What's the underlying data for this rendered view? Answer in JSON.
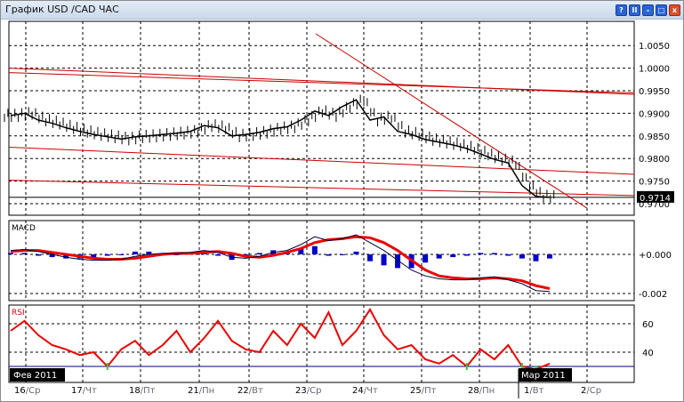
{
  "window": {
    "title": "График USD /CAD  ЧАС",
    "buttons": [
      {
        "name": "help",
        "glyph": "?"
      },
      {
        "name": "pause",
        "glyph": "II"
      },
      {
        "name": "minimize",
        "glyph": "–"
      },
      {
        "name": "restore",
        "glyph": "□"
      },
      {
        "name": "close",
        "glyph": "x"
      }
    ]
  },
  "colors": {
    "price": "#000000",
    "trend": "#cc0000",
    "macd_line": "#000033",
    "signal": "#ee0000",
    "histogram": "#0000cc",
    "rsi": "#ee0000",
    "rsi_level": "#000080",
    "highlight": "#33cc33"
  },
  "chart_data": [
    {
      "type": "line",
      "name": "price",
      "title": "USD/CAD H1",
      "yticks": [
        "1.0050",
        "1.0000",
        "0.9950",
        "0.9900",
        "0.9850",
        "0.9800",
        "0.9750",
        "0.9700"
      ],
      "ylim": [
        0.9685,
        1.0095
      ],
      "current_price": "0.9714",
      "closes": [
        0.9895,
        0.99,
        0.9885,
        0.9878,
        0.9868,
        0.986,
        0.9853,
        0.9848,
        0.9843,
        0.9848,
        0.985,
        0.9853,
        0.9856,
        0.986,
        0.9873,
        0.9868,
        0.985,
        0.9853,
        0.9858,
        0.9866,
        0.987,
        0.9885,
        0.9905,
        0.9895,
        0.9915,
        0.993,
        0.9885,
        0.9892,
        0.986,
        0.9853,
        0.9842,
        0.9836,
        0.983,
        0.9822,
        0.981,
        0.9798,
        0.979,
        0.974,
        0.9716,
        0.9714
      ],
      "trendlines": [
        {
          "from": 1.0,
          "to": 0.9942
        },
        {
          "from": 0.999,
          "to": 0.9945
        },
        {
          "from": 0.9825,
          "to": 0.9765
        },
        {
          "from": 0.9752,
          "to": 0.9718
        }
      ],
      "diagonal": {
        "from": 1.0076,
        "to": 0.969
      }
    },
    {
      "type": "line",
      "name": "MACD",
      "label": "MACD",
      "yticks": [
        "+0.000",
        "-0.002"
      ],
      "unit": 0.001,
      "macd": [
        0.2,
        0.25,
        0.15,
        0.0,
        -0.15,
        -0.25,
        -0.3,
        -0.3,
        -0.25,
        -0.1,
        0.0,
        0.05,
        0.05,
        0.1,
        0.2,
        0.1,
        -0.15,
        -0.2,
        -0.1,
        0.1,
        0.2,
        0.5,
        0.9,
        0.7,
        0.8,
        1.0,
        0.6,
        0.2,
        -0.3,
        -0.8,
        -1.1,
        -1.25,
        -1.3,
        -1.3,
        -1.2,
        -1.15,
        -1.3,
        -1.5,
        -1.85,
        -1.9
      ],
      "signal": [
        0.15,
        0.2,
        0.2,
        0.1,
        0.0,
        -0.1,
        -0.2,
        -0.25,
        -0.25,
        -0.2,
        -0.1,
        0.0,
        0.05,
        0.05,
        0.1,
        0.15,
        0.05,
        -0.1,
        -0.15,
        -0.05,
        0.1,
        0.3,
        0.6,
        0.75,
        0.8,
        0.9,
        0.85,
        0.6,
        0.2,
        -0.3,
        -0.8,
        -1.1,
        -1.2,
        -1.25,
        -1.25,
        -1.2,
        -1.25,
        -1.35,
        -1.6,
        -1.75
      ]
    },
    {
      "type": "line",
      "name": "RSI",
      "label": "RSI",
      "yticks": [
        "60",
        "40"
      ],
      "level": 30,
      "values": [
        55,
        62,
        52,
        45,
        42,
        38,
        40,
        30,
        42,
        48,
        38,
        45,
        55,
        40,
        50,
        62,
        48,
        42,
        40,
        55,
        45,
        60,
        50,
        68,
        45,
        55,
        70,
        52,
        42,
        45,
        35,
        32,
        38,
        30,
        42,
        35,
        45,
        30,
        28,
        32
      ]
    }
  ],
  "xaxis": {
    "ticks": [
      {
        "day": "16",
        "wd": "Ср"
      },
      {
        "day": "17",
        "wd": "Чт"
      },
      {
        "day": "18",
        "wd": "Пт"
      },
      {
        "day": "21",
        "wd": "Пн"
      },
      {
        "day": "22",
        "wd": "Вт"
      },
      {
        "day": "23",
        "wd": "Ср"
      },
      {
        "day": "24",
        "wd": "Чт"
      },
      {
        "day": "25",
        "wd": "Пт"
      },
      {
        "day": "28",
        "wd": "Пн"
      },
      {
        "day": "1",
        "wd": "Вт"
      },
      {
        "day": "2",
        "wd": "Ср"
      }
    ],
    "month_labels": [
      "Фев 2011",
      "Мар 2011"
    ]
  }
}
